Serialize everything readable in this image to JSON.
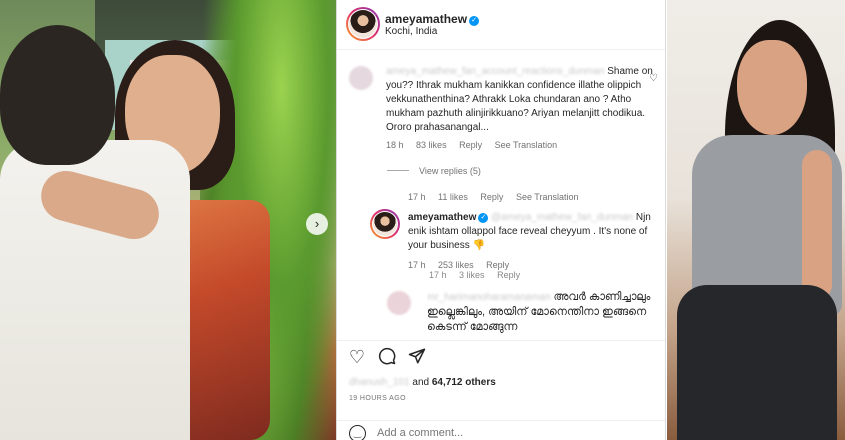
{
  "post": {
    "username": "ameyamathew",
    "location": "Kochi, India"
  },
  "comments": [
    {
      "author": "ameya_mathew_fan_account_reactions_dunman",
      "text": "Shame on you?? Ithrak mukham kanikkan confidence illathe olippich vekkunathenthina? Athrakk Loka chundaran ano ? Atho mukham pazhuth alinjirikkuano? Ariyan melanjitt chodikua. Ororo prahasanangal...",
      "time": "18 h",
      "likes": "83 likes",
      "reply": "Reply",
      "translation": "See Translation"
    }
  ],
  "view_replies": "View replies (5)",
  "thread_meta": {
    "time": "17 h",
    "likes": "11 likes",
    "reply": "Reply",
    "translation": "See Translation"
  },
  "owner_reply": {
    "author": "ameyamathew",
    "mention": "@ameya_mathew_fan_dunman",
    "text": "Njn enik ishtam ollappol face reveal cheyyum . It's none of your business",
    "emoji": "👎",
    "time": "17 h",
    "likes": "253 likes",
    "reply": "Reply"
  },
  "partial_meta": {
    "time": "17 h",
    "likes": "3 likes",
    "reply": "Reply"
  },
  "mal_comment": {
    "author": "mr_harimanoharamanaman",
    "text": "അവർ കാണിച്ചാലും ഇല്ലെങ്കിലും, അയിന് മോനെന്തിനാ ഇങ്ങനെ കെടന്ന് മോങ്ങുന്ന"
  },
  "actions": {
    "like_icon": "heart-icon",
    "comment_icon": "comment-icon",
    "share_icon": "share-icon"
  },
  "likes_line": {
    "blurred_name": "dhanush_101",
    "and_text": "and",
    "count": "64,712 others"
  },
  "time_ago": "19 HOURS AGO",
  "add_comment": {
    "placeholder": "Add a comment..."
  }
}
